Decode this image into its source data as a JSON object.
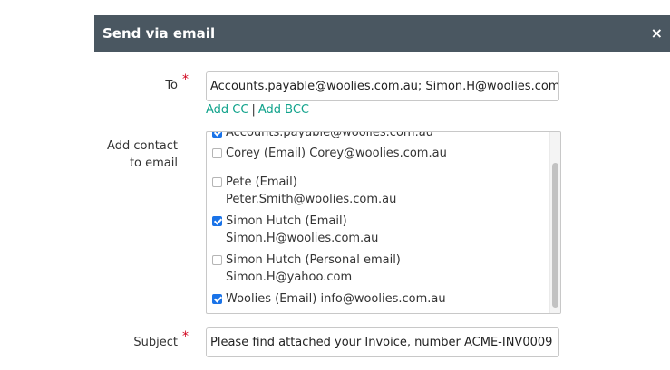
{
  "dialog": {
    "title": "Send via email",
    "close_symbol": "×"
  },
  "to": {
    "label": "To",
    "required_mark": "*",
    "value": "Accounts.payable@woolies.com.au; Simon.H@woolies.com.au; info@woolies.com.au"
  },
  "links": {
    "add_cc": "Add CC",
    "separator": "|",
    "add_bcc": "Add BCC"
  },
  "contacts": {
    "label_line1": "Add contact",
    "label_line2": "to email",
    "items": [
      {
        "line1": "Accounts.payable@woolies.com.au",
        "line2": "",
        "checked": true
      },
      {
        "line1": "Corey (Email) Corey@woolies.com.au",
        "line2": "",
        "checked": false
      },
      {
        "line1": "Pete (Email)",
        "line2": "Peter.Smith@woolies.com.au",
        "checked": false
      },
      {
        "line1": "Simon Hutch (Email)",
        "line2": "Simon.H@woolies.com.au",
        "checked": true
      },
      {
        "line1": "Simon Hutch (Personal email)",
        "line2": "Simon.H@yahoo.com",
        "checked": false
      },
      {
        "line1": "Woolies (Email) info@woolies.com.au",
        "line2": "",
        "checked": true
      }
    ]
  },
  "subject": {
    "label": "Subject",
    "required_mark": "*",
    "value": "Please find attached your Invoice, number ACME-INV0009"
  },
  "colors": {
    "header_bg": "#4a5761",
    "link": "#12a38c",
    "required": "#d0021b",
    "checkbox_checked": "#1a73e8"
  },
  "icons": {
    "close": "close-icon",
    "checkbox": "checkbox-icon"
  }
}
